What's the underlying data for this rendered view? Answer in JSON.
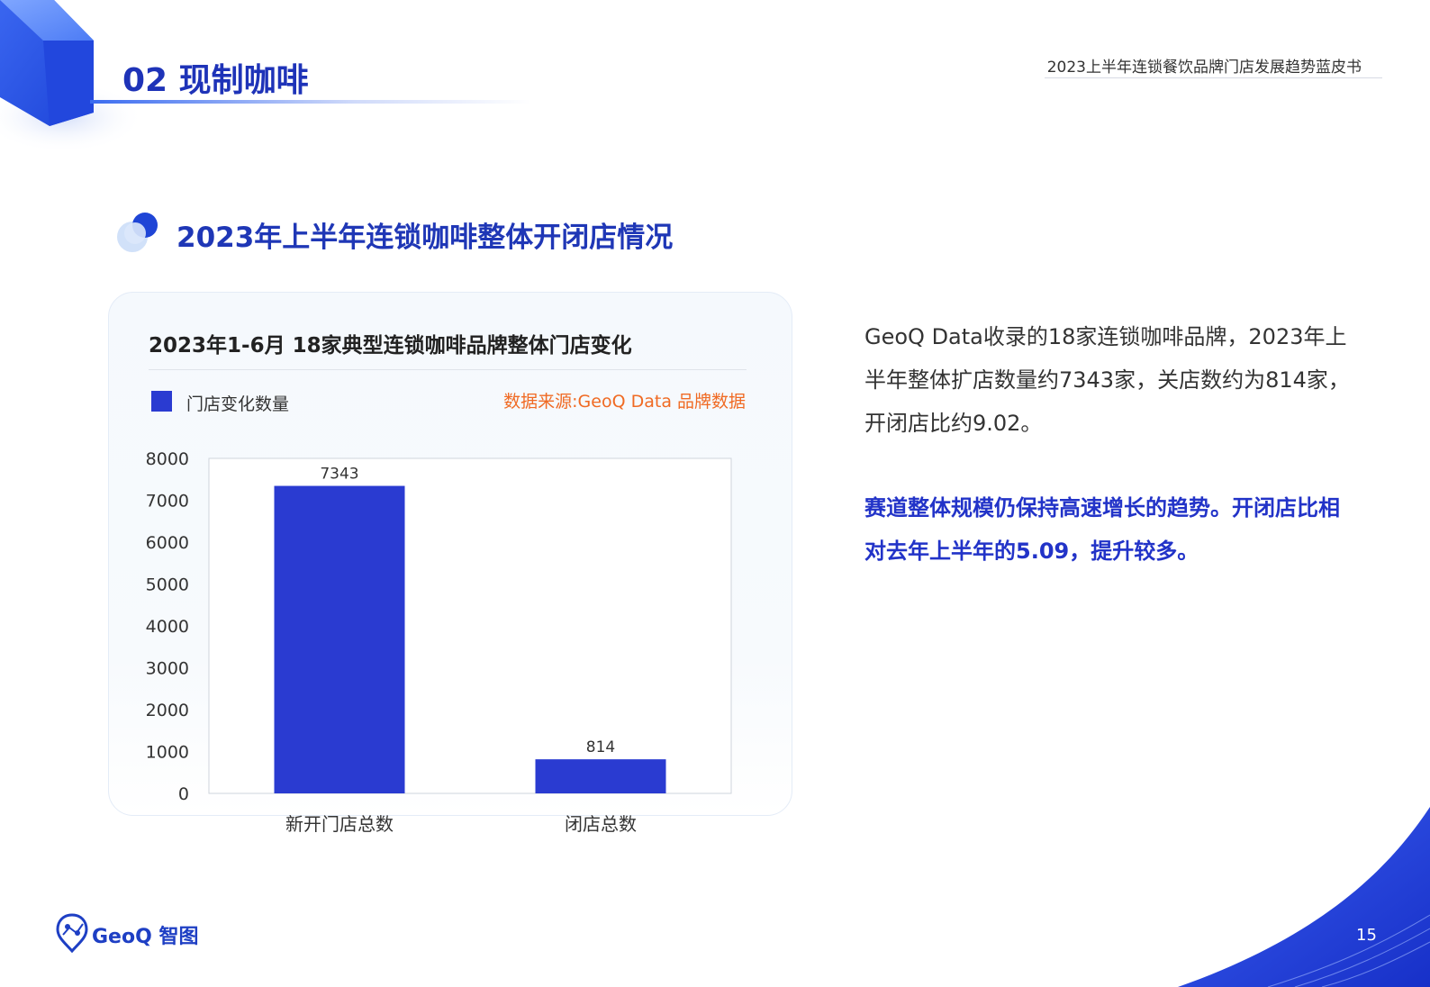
{
  "header": {
    "section_title": "02 现制咖啡",
    "report_title": "2023上半年连锁餐饮品牌门店发展趋势蓝皮书"
  },
  "sub_heading": "2023年上半年连锁咖啡整体开闭店情况",
  "chart_card": {
    "title": "2023年1-6月 18家典型连锁咖啡品牌整体门店变化",
    "legend_label": "门店变化数量",
    "source": "数据来源:GeoQ Data 品牌数据"
  },
  "chart_data": {
    "type": "bar",
    "categories": [
      "新开门店总数",
      "闭店总数"
    ],
    "series": [
      {
        "name": "门店变化数量",
        "values": [
          7343,
          814
        ]
      }
    ],
    "data_labels": [
      "7343",
      "814"
    ],
    "y_ticks": [
      "0",
      "1000",
      "2000",
      "3000",
      "4000",
      "5000",
      "6000",
      "7000",
      "8000"
    ],
    "ylim": [
      0,
      8000
    ],
    "title": "2023年1-6月 18家典型连锁咖啡品牌整体门店变化",
    "xlabel": "",
    "ylabel": "",
    "grid": false,
    "legend_position": "top-left",
    "bar_color": "#2a3bd1"
  },
  "text": {
    "paragraph_1": "GeoQ Data收录的18家连锁咖啡品牌，2023年上半年整体扩店数量约7343家，关店数约为814家，开闭店比约9.02。",
    "paragraph_2": "赛道整体规模仍保持高速增长的趋势。开闭店比相对去年上半年的5.09，提升较多。"
  },
  "footer": {
    "brand": "GeoQ 智图",
    "page_number": "15"
  },
  "colors": {
    "title_blue": "#1e33b8",
    "accent_orange": "#f06a23",
    "bar_blue": "#2a3bd1"
  }
}
